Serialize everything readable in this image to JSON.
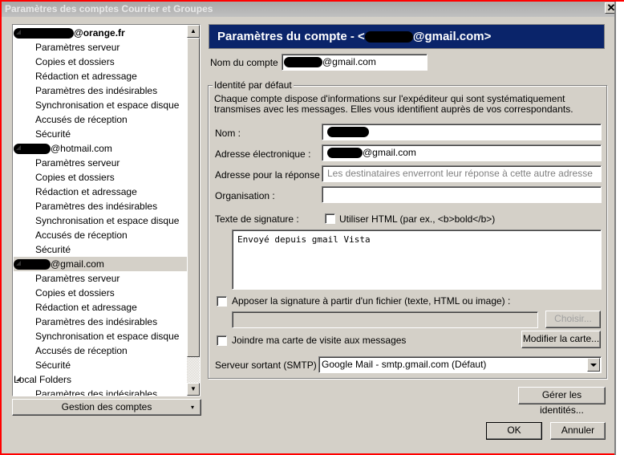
{
  "window": {
    "title": "Paramètres des comptes Courrier et Groupes",
    "close_icon": "close-icon"
  },
  "tree": {
    "items": [
      {
        "kind": "account",
        "label": "@orange.fr",
        "redact_width": 75,
        "bold": true
      },
      {
        "kind": "sub",
        "label": "Paramètres serveur"
      },
      {
        "kind": "sub",
        "label": "Copies et dossiers"
      },
      {
        "kind": "sub",
        "label": "Rédaction et adressage"
      },
      {
        "kind": "sub",
        "label": "Paramètres des indésirables"
      },
      {
        "kind": "sub",
        "label": "Synchronisation et espace disque"
      },
      {
        "kind": "sub",
        "label": "Accusés de réception"
      },
      {
        "kind": "sub",
        "label": "Sécurité"
      },
      {
        "kind": "account",
        "label": "@hotmail.com",
        "redact_width": 46
      },
      {
        "kind": "sub",
        "label": "Paramètres serveur"
      },
      {
        "kind": "sub",
        "label": "Copies et dossiers"
      },
      {
        "kind": "sub",
        "label": "Rédaction et adressage"
      },
      {
        "kind": "sub",
        "label": "Paramètres des indésirables"
      },
      {
        "kind": "sub",
        "label": "Synchronisation et espace disque"
      },
      {
        "kind": "sub",
        "label": "Accusés de réception"
      },
      {
        "kind": "sub",
        "label": "Sécurité"
      },
      {
        "kind": "account",
        "label": "@gmail.com",
        "redact_width": 46,
        "selected": true
      },
      {
        "kind": "sub",
        "label": "Paramètres serveur"
      },
      {
        "kind": "sub",
        "label": "Copies et dossiers"
      },
      {
        "kind": "sub",
        "label": "Rédaction et adressage"
      },
      {
        "kind": "sub",
        "label": "Paramètres des indésirables"
      },
      {
        "kind": "sub",
        "label": "Synchronisation et espace disque"
      },
      {
        "kind": "sub",
        "label": "Accusés de réception"
      },
      {
        "kind": "sub",
        "label": "Sécurité"
      },
      {
        "kind": "account",
        "label": "Local Folders"
      },
      {
        "kind": "sub",
        "label": "Paramètres des indésirables"
      }
    ],
    "manage_button": "Gestion des comptes"
  },
  "main": {
    "header_prefix": "Paramètres du compte - <",
    "header_suffix": "@gmail.com>",
    "account_name_label": "Nom du compte :",
    "account_name_value": "@gmail.com",
    "identity": {
      "legend": "Identité par défaut",
      "description": "Chaque compte dispose d'informations sur l'expéditeur qui sont systématiquement transmises avec les messages. Elles vous identifient auprès de vos correspondants.",
      "name_label": "Nom :",
      "email_label": "Adresse électronique :",
      "email_value": "@gmail.com",
      "reply_label": "Adresse pour la réponse :",
      "reply_placeholder": "Les destinataires enverront leur réponse à cette autre adresse",
      "org_label": "Organisation :",
      "signature_label": "Texte de signature :",
      "use_html_label": "Utiliser HTML (par ex., <b>bold</b>)",
      "use_html_checked": false,
      "signature_text": "Envoyé depuis gmail Vista",
      "sig_file_label": "Apposer la signature à partir d'un fichier (texte, HTML ou image) :",
      "sig_file_checked": false,
      "choose_button": "Choisir...",
      "vcard_label": "Joindre ma carte de visite aux messages",
      "vcard_checked": false,
      "edit_card_button": "Modifier la carte...",
      "smtp_label": "Serveur sortant (SMTP) :",
      "smtp_value": "Google Mail - smtp.gmail.com (Défaut)"
    },
    "manage_identities_button": "Gérer les identités...",
    "ok_button": "OK",
    "cancel_button": "Annuler"
  },
  "colors": {
    "header_bg": "#0a246a",
    "dialog_bg": "#d4d0c8",
    "frame_border": "#ff0000"
  }
}
